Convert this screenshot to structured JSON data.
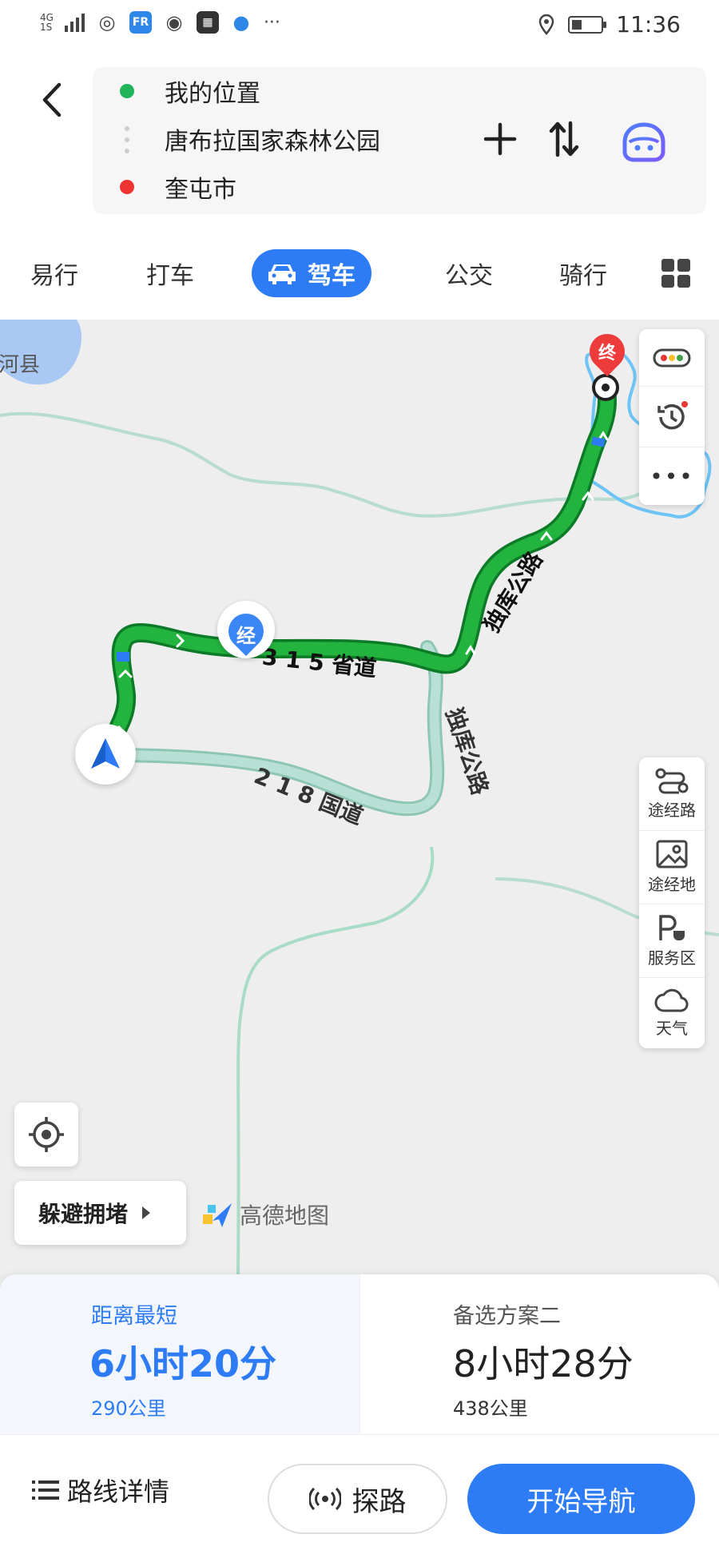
{
  "status_bar": {
    "network": "4G",
    "network_sub": "1S",
    "location_icon": "location-pin-icon",
    "time": "11:36"
  },
  "route": {
    "start": "我的位置",
    "waypoint": "唐布拉国家森林公园",
    "end": "奎屯市",
    "start_color": "#22b45a",
    "end_color": "#ee3333"
  },
  "modes": {
    "items": [
      "易行",
      "打车",
      "驾车",
      "公交",
      "骑行"
    ],
    "active": "驾车"
  },
  "map": {
    "place_label": "河县",
    "road_labels": {
      "s315": "3 1 5 省道",
      "g218": "2 1 8 国道",
      "duku_route": "独库公路",
      "duku_alt": "独库公路"
    },
    "waypoint_marker": "经",
    "end_marker": "终",
    "route_color": "#1fa13a",
    "alt_route_color": "#9fd4c8"
  },
  "tools": {
    "top": [
      "traffic-icon",
      "history-icon",
      "more-icon"
    ],
    "via_road": "途经路",
    "via_place": "途经地",
    "service_area": "服务区",
    "weather": "天气"
  },
  "avoid_label": "躲避拥堵",
  "brand": "高德地图",
  "plans": [
    {
      "name": "距离最短",
      "time": "6小时20分",
      "distance": "290公里"
    },
    {
      "name": "备选方案二",
      "time": "8小时28分",
      "distance": "438公里"
    }
  ],
  "actions": {
    "detail": "路线详情",
    "probe": "探路",
    "navigate": "开始导航"
  },
  "accent": "#2d7cf6"
}
